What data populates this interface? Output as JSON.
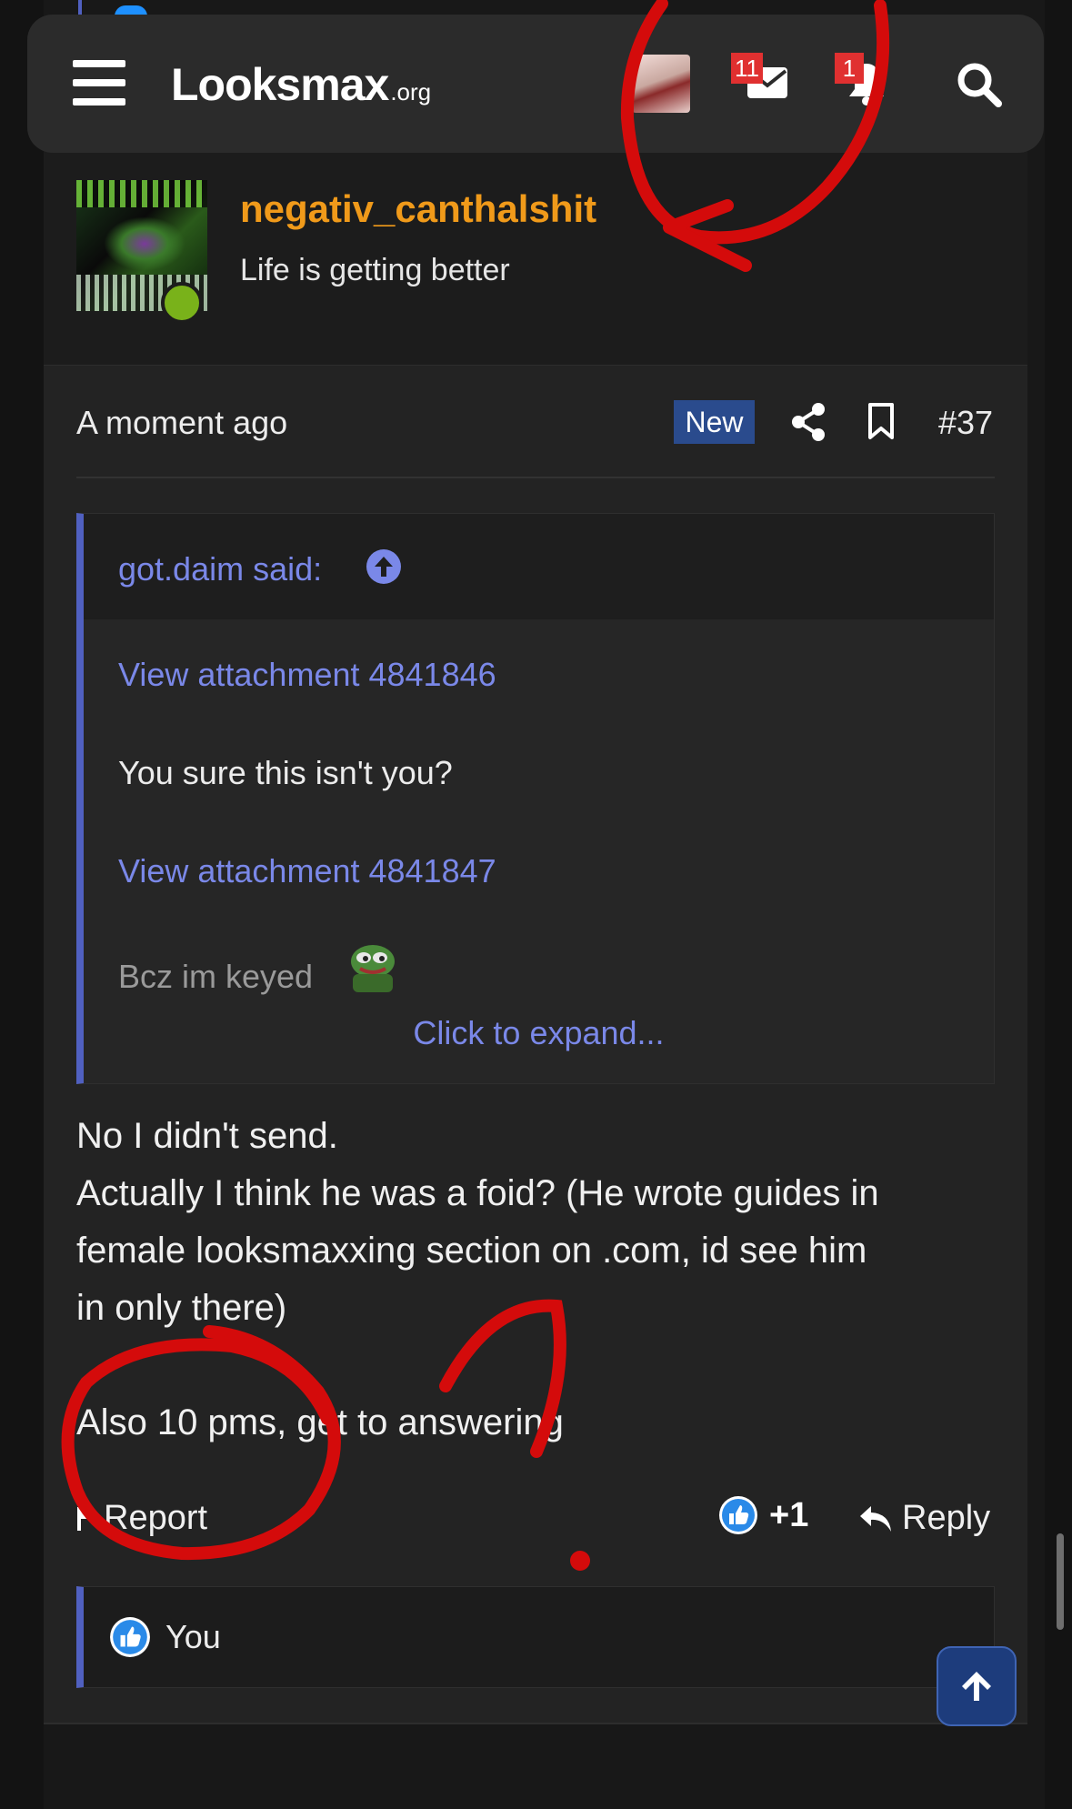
{
  "header": {
    "logo_main": "Lᴏᴏksmax",
    "logo_sub": ".org",
    "messages_count": "11",
    "alerts_count": "1"
  },
  "post": {
    "username": "negativ_canthalshit",
    "user_title": "Life is getting better",
    "time": "A moment ago",
    "new_badge": "New",
    "post_number": "#37"
  },
  "quote": {
    "author": "got.daim said:",
    "link1": "View attachment 4841846",
    "text": "You sure this isn't you?",
    "link2": "View attachment 4841847",
    "faded": "Bcz im keyed",
    "expand": "Click to expand..."
  },
  "body": {
    "line1": "No I didn't send.",
    "line2": "Actually I think he was a foid? (He wrote guides in",
    "line3": "female looksmaxxing section on .com, id see him",
    "line4": "in only there)",
    "line5": "Also 10 pms, get to answering"
  },
  "actions": {
    "report": "Report",
    "like_count": "+1",
    "reply": "Reply"
  },
  "reactions": {
    "user": "You"
  },
  "colors": {
    "accent": "#5060c0",
    "username": "#f09a1a",
    "link": "#7a88e8",
    "badge": "#e03030"
  }
}
